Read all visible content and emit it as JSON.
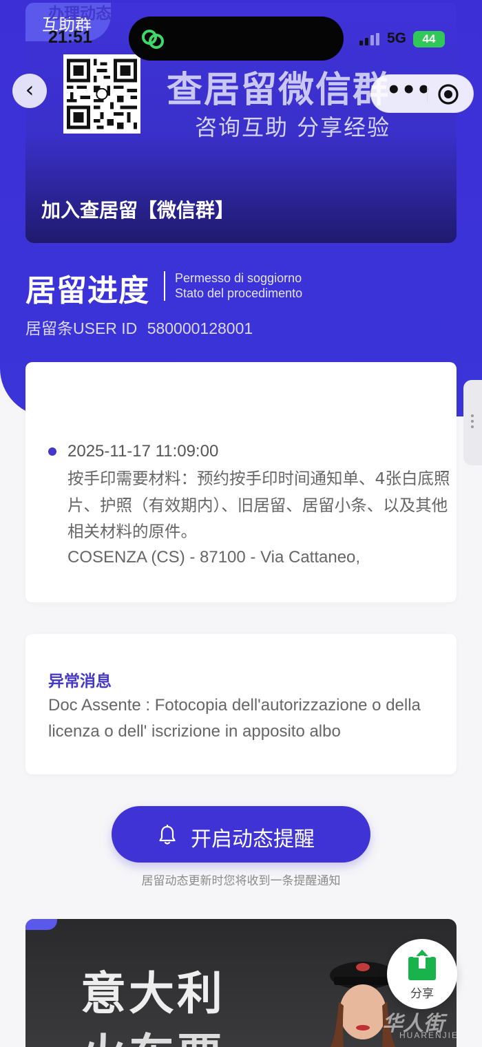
{
  "status_bar": {
    "time": "21:51",
    "network": "5G",
    "battery": "44"
  },
  "banner": {
    "tag": "互助群",
    "title": "查居留微信群",
    "subtitle": "咨询互助 分享经验",
    "join_label": "加入查居留【微信群】"
  },
  "nav": {
    "back_icon": "chevron-left-icon",
    "more_icon": "more-dots-icon",
    "close_icon": "target-close-icon"
  },
  "header": {
    "title": "居留进度",
    "subtitle_line1": "Permesso di soggiorno",
    "subtitle_line2": "Stato del procedimento",
    "user_id_label": "居留条USER ID",
    "user_id_value": "580000128001"
  },
  "progress_card": {
    "heading": "办理动态",
    "event": {
      "time": "2025-11-17 11:09:00",
      "text": "按手印需要材料：预约按手印时间通知单、4张白底照片、护照（有效期内）、旧居留、居留小条、以及其他相关材料的原件。",
      "address": "COSENZA (CS) - 87100 - Via Cattaneo,"
    }
  },
  "error_card": {
    "heading": "异常消息",
    "text": "Doc Assente : Fotocopia dell'autorizzazione o della licenza o dell' iscrizione in apposito albo"
  },
  "reminder": {
    "button_label": "开启动态提醒",
    "hint": "居留动态更新时您将收到一条提醒通知"
  },
  "ad": {
    "title_line1": "意大利",
    "title_line2": "火车票"
  },
  "share": {
    "label": "分享"
  },
  "watermark": {
    "text": "华人街",
    "sub": "HUARENJIE"
  },
  "colors": {
    "brand": "#3f33d6",
    "accent_text": "#4338ca",
    "share_green": "#18b34a"
  }
}
